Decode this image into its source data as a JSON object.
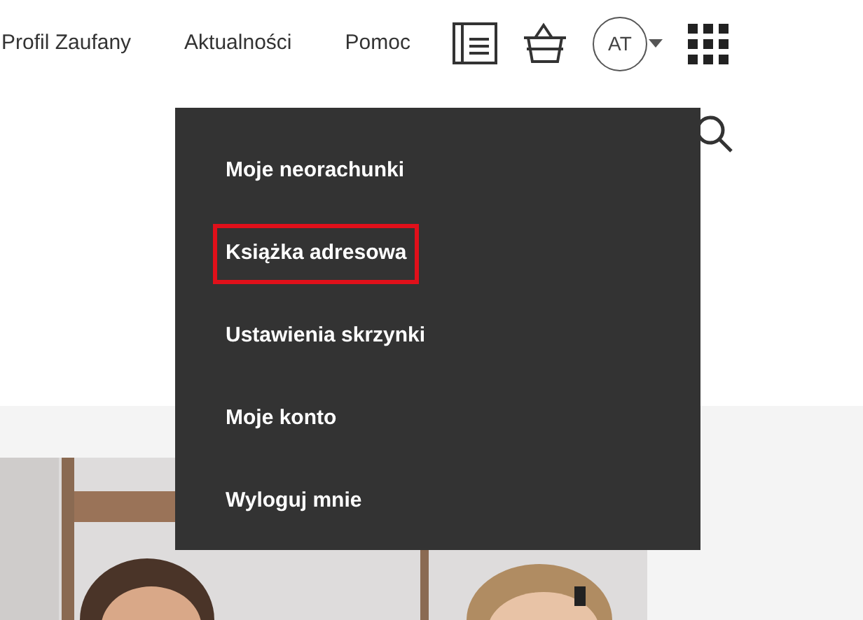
{
  "nav": [
    {
      "label": "Profil Zaufany"
    },
    {
      "label": "Aktualności"
    },
    {
      "label": "Pomoc"
    }
  ],
  "avatar": {
    "initials": "AT"
  },
  "menu": {
    "items": [
      {
        "label": "Moje neorachunki",
        "highlighted": false
      },
      {
        "label": "Książka adresowa",
        "highlighted": true
      },
      {
        "label": "Ustawienia skrzynki",
        "highlighted": false
      },
      {
        "label": "Moje konto",
        "highlighted": false
      },
      {
        "label": "Wyloguj mnie",
        "highlighted": false
      }
    ]
  }
}
